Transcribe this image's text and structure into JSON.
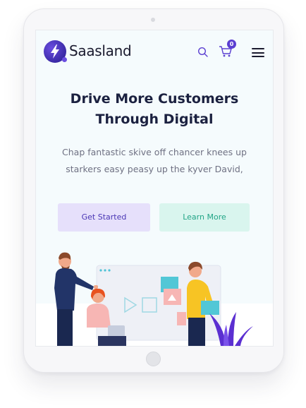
{
  "brand": {
    "name": "Saasland",
    "accent": "#5b3fd1",
    "learn_color": "#22a587"
  },
  "nav": {
    "cart_count": "0",
    "icons": [
      "search-icon",
      "cart-icon",
      "hamburger-menu-icon"
    ]
  },
  "hero": {
    "title_line1": "Drive More Customers",
    "title_line2": "Through Digital",
    "subtitle_line1": "Chap fantastic skive off chancer knees up",
    "subtitle_line2": "starkers easy peasy up the kyver David,",
    "primary_button": "Get Started",
    "secondary_button": "Learn More"
  }
}
